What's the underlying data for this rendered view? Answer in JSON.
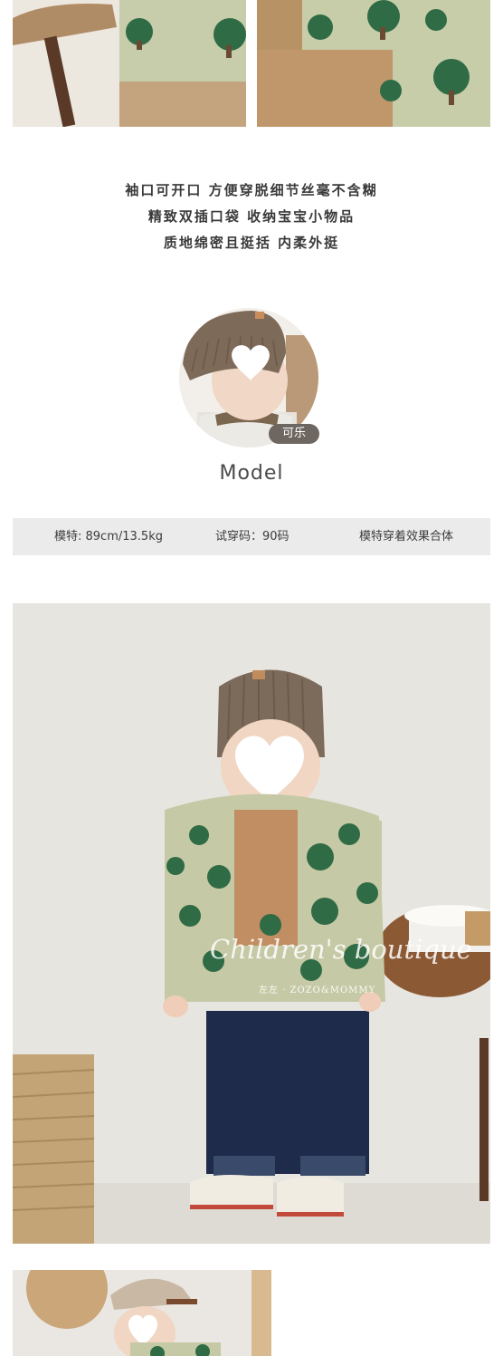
{
  "features": {
    "line1": "袖口可开口 方便穿脱细节丝毫不含糊",
    "line2": "精致双插口袋 收纳宝宝小物品",
    "line3": "质地绵密且挺括 内柔外挺"
  },
  "model": {
    "name": "可乐",
    "title": "Model"
  },
  "info_bar": {
    "model_size": "模特: 89cm/13.5kg",
    "trial_size": "试穿码：90码",
    "fit_note": "模特穿着效果合体"
  },
  "watermark": {
    "script": "Children's boutique",
    "brand": "左左 · ZOZO&MOMMY"
  }
}
